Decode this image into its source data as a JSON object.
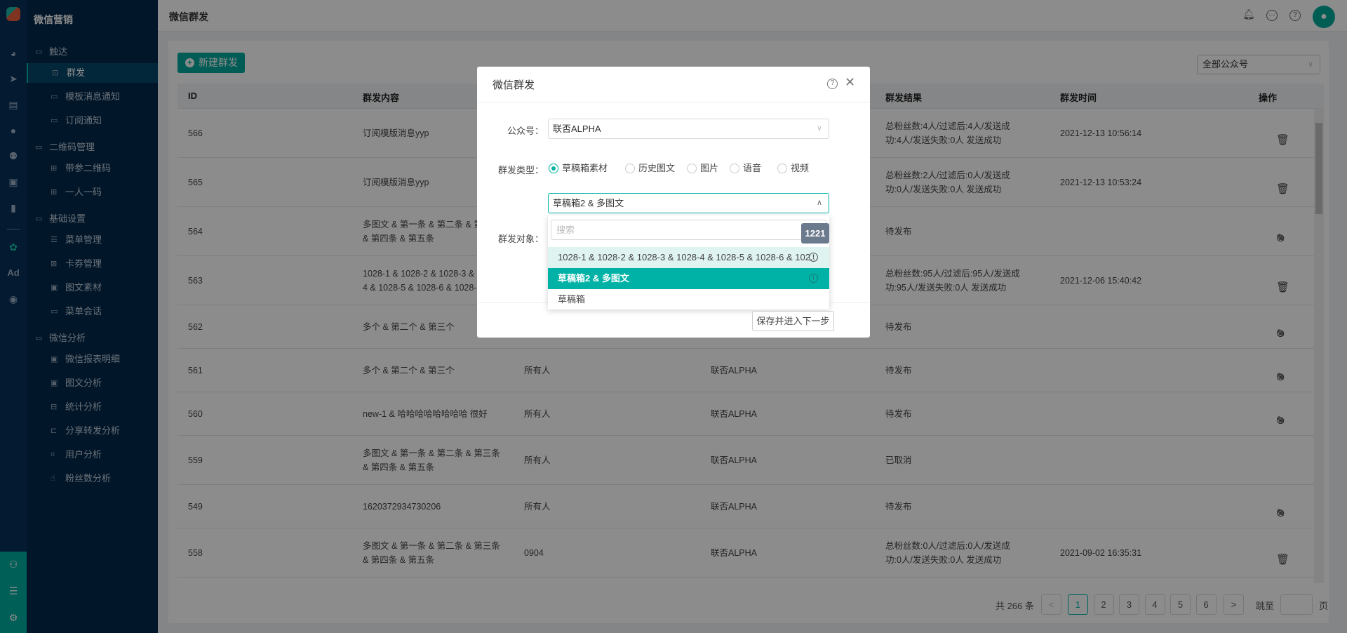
{
  "app": {
    "title": "微信营销",
    "page_title": "微信群发"
  },
  "sidebar": {
    "groups": [
      {
        "label": "触达",
        "items": [
          {
            "label": "群发",
            "active": true
          },
          {
            "label": "模板消息通知"
          },
          {
            "label": "订阅通知"
          }
        ]
      },
      {
        "label": "二维码管理",
        "items": [
          {
            "label": "带参二维码"
          },
          {
            "label": "一人一码"
          }
        ]
      },
      {
        "label": "基础设置",
        "items": [
          {
            "label": "菜单管理"
          },
          {
            "label": "卡券管理"
          },
          {
            "label": "图文素材"
          },
          {
            "label": "菜单会话"
          }
        ]
      },
      {
        "label": "微信分析",
        "items": [
          {
            "label": "微信报表明细"
          },
          {
            "label": "图文分析"
          },
          {
            "label": "统计分析"
          },
          {
            "label": "分享转发分析"
          },
          {
            "label": "用户分析"
          },
          {
            "label": "粉丝数分析"
          }
        ]
      }
    ]
  },
  "rail": {
    "ad_label": "Ad"
  },
  "toolbar": {
    "new_label": "新建群发",
    "account_filter": "全部公众号"
  },
  "table": {
    "headers": {
      "id": "ID",
      "content": "群发内容",
      "result": "群发结果",
      "time": "群发时间",
      "actions": "操作"
    },
    "rows": [
      {
        "id": "566",
        "content": "订阅模版消息yyp",
        "target": "",
        "account": "",
        "result": "总粉丝数:4人/过滤后:4人/发送成功:4人/发送失败:0人 发送成功",
        "time": "2021-12-13 10:56:14",
        "actions": "delete"
      },
      {
        "id": "565",
        "content": "订阅模版消息yyp",
        "target": "",
        "account": "",
        "result": "总粉丝数:2人/过滤后:0人/发送成功:0人/发送失败:0人 发送成功",
        "time": "2021-12-13 10:53:24",
        "actions": "delete"
      },
      {
        "id": "564",
        "content": "多图文 & 第一条 & 第二条 & 第三条 & 第四条 & 第五条",
        "target": "",
        "account": "",
        "result": "待发布",
        "time": "",
        "actions": "edit-cancel"
      },
      {
        "id": "563",
        "content": "1028-1 & 1028-2 & 1028-3 & 1028-4 & 1028-5 & 1028-6 & 1028-7",
        "target": "",
        "account": "",
        "result": "总粉丝数:95人/过滤后:95人/发送成功:95人/发送失败:0人 发送成功",
        "time": "2021-12-06 15:40:42",
        "actions": "delete"
      },
      {
        "id": "562",
        "content": "多个 & 第二个 & 第三个",
        "target": "",
        "account": "",
        "result": "待发布",
        "time": "",
        "actions": "edit-cancel"
      },
      {
        "id": "561",
        "content": "多个 & 第二个 & 第三个",
        "target": "所有人",
        "account": "联否ALPHA",
        "result": "待发布",
        "time": "",
        "actions": "edit-cancel"
      },
      {
        "id": "560",
        "content": "new-1 & 哈哈哈哈哈哈哈哈 很好",
        "target": "所有人",
        "account": "联否ALPHA",
        "result": "待发布",
        "time": "",
        "actions": "edit-cancel"
      },
      {
        "id": "559",
        "content": "多图文 & 第一条 & 第二条 & 第三条 & 第四条 & 第五条",
        "target": "所有人",
        "account": "联否ALPHA",
        "result": "已取消",
        "time": "",
        "actions": "none"
      },
      {
        "id": "549",
        "content": "1620372934730206",
        "target": "所有人",
        "account": "联否ALPHA",
        "result": "待发布",
        "time": "",
        "actions": "edit-cancel"
      },
      {
        "id": "558",
        "content": "多图文 & 第一条 & 第二条 & 第三条 & 第四条 & 第五条",
        "target": "0904",
        "account": "联否ALPHA",
        "result": "总粉丝数:0人/过滤后:0人/发送成功:0人/发送失败:0人 发送成功",
        "time": "2021-09-02 16:35:31",
        "actions": "delete"
      }
    ]
  },
  "pagination": {
    "total": "共 266 条",
    "pages": [
      "1",
      "2",
      "3",
      "4",
      "5",
      "6"
    ],
    "current": "1",
    "prev": "<",
    "next": ">",
    "jump_label": "跳至",
    "page_suffix": "页",
    "jump_value": ""
  },
  "modal": {
    "title": "微信群发",
    "account_label": "公众号：",
    "account_value": "联否ALPHA",
    "type_label": "群发类型：",
    "types": [
      {
        "label": "草稿箱素材",
        "checked": true
      },
      {
        "label": "历史图文"
      },
      {
        "label": "图片"
      },
      {
        "label": "语音"
      },
      {
        "label": "视频"
      }
    ],
    "material_value": "草稿箱2 & 多图文",
    "target_label": "群发对象：",
    "dropdown": {
      "search_placeholder": "搜索",
      "options": [
        {
          "label": "1028-1 & 1028-2 & 1028-3 & 1028-4 & 1028-5 & 1028-6 & 102...",
          "state": "hover"
        },
        {
          "label": "草稿箱2 & 多图文",
          "state": "selected"
        },
        {
          "label": "草稿箱",
          "state": ""
        }
      ],
      "tooltip": "1221"
    },
    "save_label": "保存并进入下一步"
  },
  "colors": {
    "accent": "#00b2a6",
    "sidebar": "#03294c"
  }
}
